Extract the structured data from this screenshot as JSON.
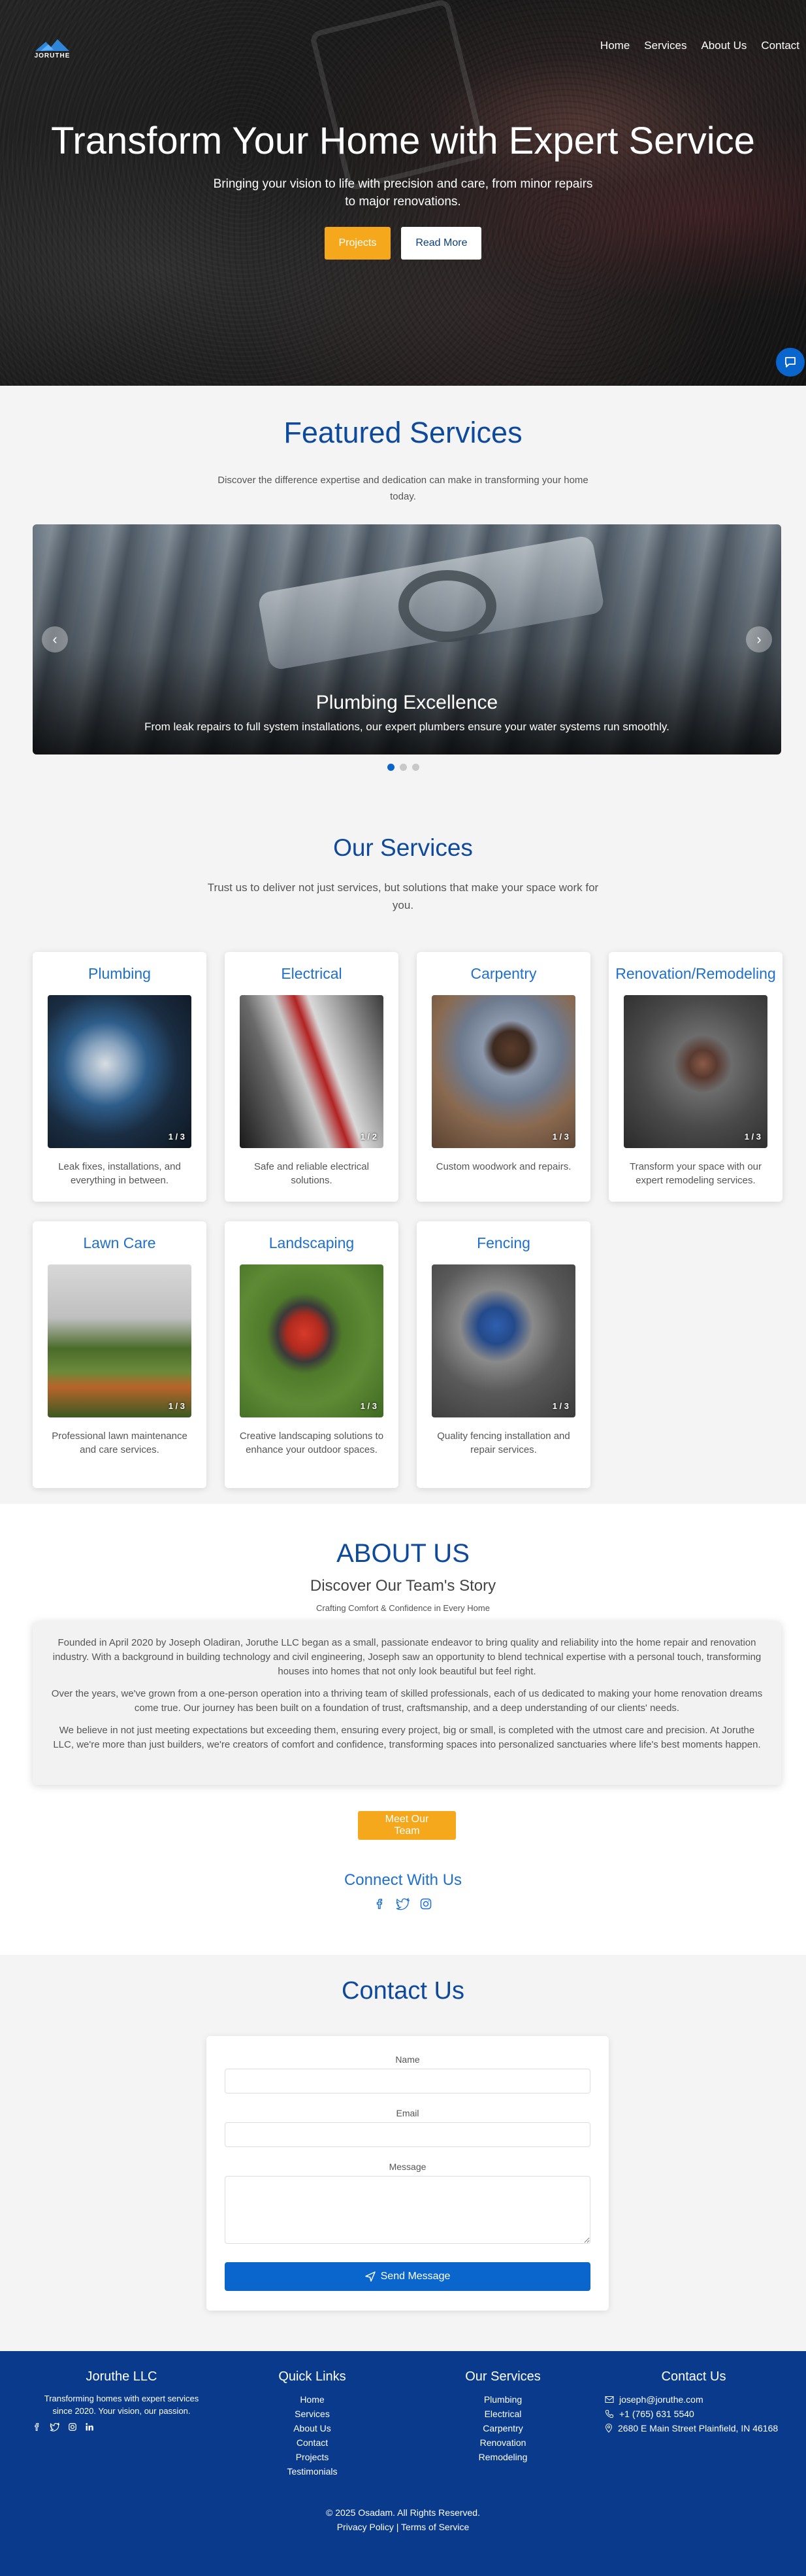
{
  "nav": {
    "logo_text": "JORUTHE",
    "links": [
      "Home",
      "Services",
      "About Us",
      "Contact"
    ]
  },
  "hero": {
    "title": "Transform Your Home with Expert Service",
    "subtitle": "Bringing your vision to life with precision and care, from minor repairs to major renovations.",
    "btn_projects": "Projects",
    "btn_readmore": "Read More"
  },
  "featured": {
    "title": "Featured Services",
    "description": "Discover the difference expertise and dedication can make in transforming your home today.",
    "slide_title": "Plumbing Excellence",
    "slide_text": "From leak repairs to full system installations, our expert plumbers ensure your water systems run smoothly.",
    "dots": 3,
    "active_dot": 0
  },
  "services": {
    "title": "Our Services",
    "description": "Trust us to deliver not just services, but solutions that make your space work for you.",
    "cards": [
      {
        "title": "Plumbing",
        "counter": "1 / 3",
        "desc": "Leak fixes, installations, and everything in between."
      },
      {
        "title": "Electrical",
        "counter": "1 / 2",
        "desc": "Safe and reliable electrical solutions."
      },
      {
        "title": "Carpentry",
        "counter": "1 / 3",
        "desc": "Custom woodwork and repairs."
      },
      {
        "title": "Renovation/Remodeling",
        "counter": "1 / 3",
        "desc": "Transform your space with our expert remodeling services."
      },
      {
        "title": "Lawn Care",
        "counter": "1 / 3",
        "desc": "Professional lawn maintenance and care services."
      },
      {
        "title": "Landscaping",
        "counter": "1 / 3",
        "desc": "Creative landscaping solutions to enhance your outdoor spaces."
      },
      {
        "title": "Fencing",
        "counter": "1 / 3",
        "desc": "Quality fencing installation and repair services."
      }
    ]
  },
  "about": {
    "title": "ABOUT US",
    "subtitle": "Discover Our Team's Story",
    "tagline": "Crafting Comfort & Confidence in Every Home",
    "paragraphs": [
      "Founded in April 2020 by Joseph Oladiran, Joruthe LLC began as a small, passionate endeavor to bring quality and reliability into the home repair and renovation industry. With a background in building technology and civil engineering, Joseph saw an opportunity to blend technical expertise with a personal touch, transforming houses into homes that not only look beautiful but feel right.",
      "Over the years, we've grown from a one-person operation into a thriving team of skilled professionals, each of us dedicated to making your home renovation dreams come true. Our journey has been built on a foundation of trust, craftsmanship, and a deep understanding of our clients' needs.",
      "We believe in not just meeting expectations but exceeding them, ensuring every project, big or small, is completed with the utmost care and precision. At Joruthe LLC, we're more than just builders, we're creators of comfort and confidence, transforming spaces into personalized sanctuaries where life's best moments happen."
    ],
    "team_button": "Meet Our Team",
    "connect_title": "Connect With Us"
  },
  "contact": {
    "title": "Contact Us",
    "name_label": "Name",
    "email_label": "Email",
    "message_label": "Message",
    "send_label": "Send Message"
  },
  "footer": {
    "company": "Joruthe LLC",
    "about": "Transforming homes with expert services since 2020. Your vision, our passion.",
    "quick_links_title": "Quick Links",
    "quick_links": [
      "Home",
      "Services",
      "About Us",
      "Contact",
      "Projects",
      "Testimonials"
    ],
    "services_title": "Our Services",
    "services": [
      "Plumbing",
      "Electrical",
      "Carpentry",
      "Renovation",
      "Remodeling"
    ],
    "contact_title": "Contact Us",
    "email": "joseph@joruthe.com",
    "phone": "+1 (765) 631 5540",
    "address": "2680 E Main Street Plainfield, IN 46168",
    "copyright": "© 2025 Osadam. All Rights Reserved.",
    "privacy": "Privacy Policy",
    "separator": "|",
    "terms": "Terms of Service"
  },
  "colors": {
    "primary": "#0a66cc",
    "heading_blue": "#0d4a9e",
    "accent_yellow": "#f6a81c",
    "footer_bg": "#0a3a8c"
  }
}
